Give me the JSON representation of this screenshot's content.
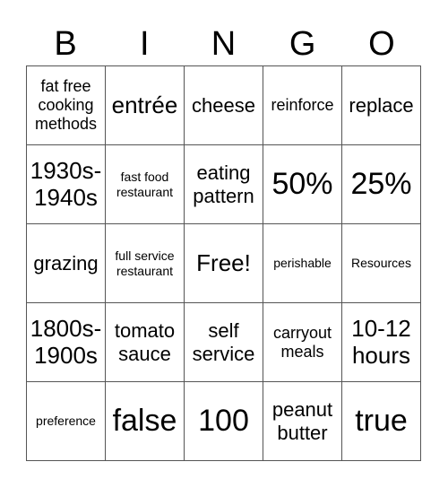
{
  "header": [
    "B",
    "I",
    "N",
    "G",
    "O"
  ],
  "cells": [
    {
      "text": "fat free cooking methods",
      "size": "s-md"
    },
    {
      "text": "entrée",
      "size": "s-xl"
    },
    {
      "text": "cheese",
      "size": "s-lg"
    },
    {
      "text": "reinforce",
      "size": "s-md"
    },
    {
      "text": "replace",
      "size": "s-lg"
    },
    {
      "text": "1930s-1940s",
      "size": "s-xl"
    },
    {
      "text": "fast food restaurant",
      "size": "s-xs"
    },
    {
      "text": "eating pattern",
      "size": "s-lg"
    },
    {
      "text": "50%",
      "size": "s-xxl"
    },
    {
      "text": "25%",
      "size": "s-xxl"
    },
    {
      "text": "grazing",
      "size": "s-lg"
    },
    {
      "text": "full service restaurant",
      "size": "s-xs"
    },
    {
      "text": "Free!",
      "size": "s-xl"
    },
    {
      "text": "perishable",
      "size": "s-xs"
    },
    {
      "text": "Resources",
      "size": "s-xs"
    },
    {
      "text": "1800s-1900s",
      "size": "s-xl"
    },
    {
      "text": "tomato sauce",
      "size": "s-lg"
    },
    {
      "text": "self service",
      "size": "s-lg"
    },
    {
      "text": "carryout meals",
      "size": "s-md"
    },
    {
      "text": "10-12 hours",
      "size": "s-xl"
    },
    {
      "text": "preference",
      "size": "s-xs"
    },
    {
      "text": "false",
      "size": "s-xxl"
    },
    {
      "text": "100",
      "size": "s-xxl"
    },
    {
      "text": "peanut butter",
      "size": "s-lg"
    },
    {
      "text": "true",
      "size": "s-xxl"
    }
  ]
}
